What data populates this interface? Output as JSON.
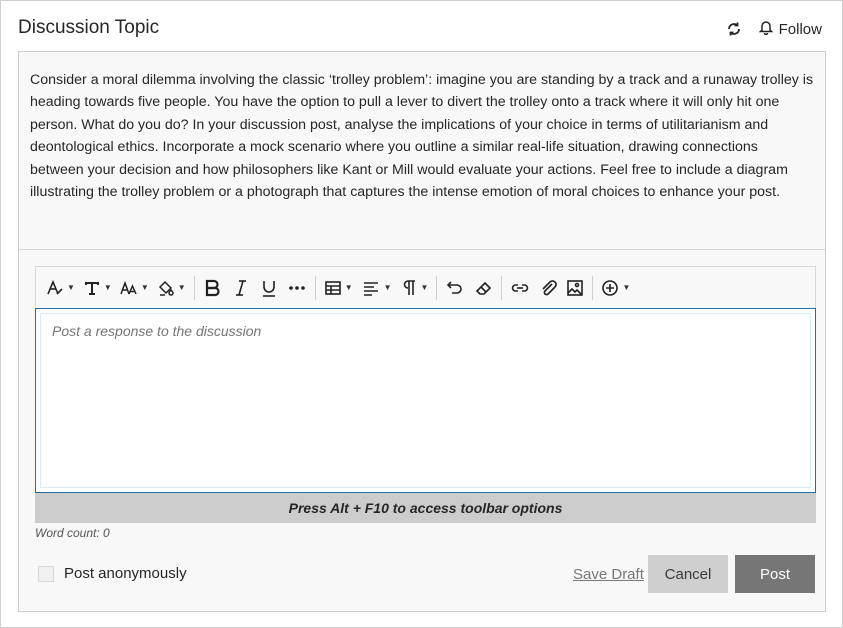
{
  "header": {
    "title": "Discussion Topic",
    "follow_label": "Follow"
  },
  "prompt": {
    "text": "Consider a moral dilemma involving the classic ‘trolley problem’: imagine you are standing by a track and a runaway trolley is heading towards five people. You have the option to pull a lever to divert the trolley onto a track where it will only hit one person. What do you do? In your discussion post, analyse the implications of your choice in terms of utilitarianism and deontological ethics. Incorporate a mock scenario where you outline a similar real-life situation, drawing connections between your decision and how philosophers like Kant or Mill would evaluate your actions. Feel free to include a diagram illustrating the trolley problem or a photograph that captures the intense emotion of moral choices to enhance your post."
  },
  "editor": {
    "toolbar_icons": [
      "text-style-icon",
      "font-family-icon",
      "font-size-icon",
      "text-color-icon",
      "bold-icon",
      "italic-icon",
      "underline-icon",
      "more-icon",
      "table-icon",
      "align-icon",
      "paragraph-icon",
      "undo-icon",
      "eraser-icon",
      "link-icon",
      "attachment-icon",
      "image-icon",
      "insert-icon"
    ],
    "placeholder": "Post a response to the discussion",
    "hint": "Press Alt + F10 to access toolbar options",
    "word_count": "Word count: 0"
  },
  "footer": {
    "anonymous_label": "Post anonymously",
    "anonymous_checked": false,
    "save_draft_label": "Save Draft",
    "cancel_label": "Cancel",
    "post_label": "Post"
  },
  "colors": {
    "post_button": "#767676",
    "cancel_button": "#cfcfcf",
    "editor_focus_border": "#1f6fa8",
    "hint_bar": "#cccccc"
  }
}
